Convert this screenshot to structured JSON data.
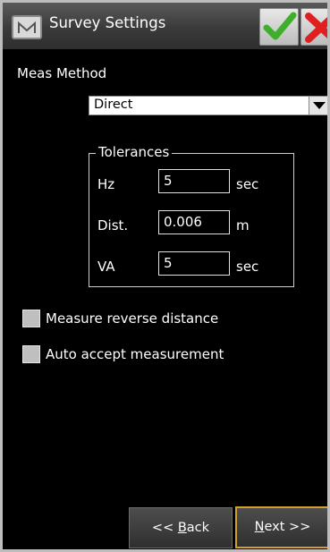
{
  "window": {
    "title": "Survey Settings"
  },
  "meas_method": {
    "label": "Meas Method",
    "selected": "Direct"
  },
  "tolerances": {
    "group_label": "Tolerances",
    "rows": [
      {
        "label": "Hz",
        "value": "5",
        "unit": "sec"
      },
      {
        "label": "Dist.",
        "value": "0.006",
        "unit": "m"
      },
      {
        "label": "VA",
        "value": "5",
        "unit": "sec"
      }
    ]
  },
  "options": {
    "measure_reverse": {
      "label": "Measure reverse distance",
      "checked": false
    },
    "auto_accept": {
      "label": "Auto accept measurement",
      "checked": false
    }
  },
  "nav": {
    "back": {
      "prefix": "<< ",
      "accel": "B",
      "rest": "ack"
    },
    "next": {
      "accel": "N",
      "rest": "ext >>"
    }
  },
  "colors": {
    "ok_green": "#3fae2a",
    "cancel_red": "#e02020",
    "focus_border": "#d4a02a"
  },
  "icons": {
    "app": "app-m-icon",
    "ok": "checkmark-icon",
    "cancel": "close-icon",
    "dropdown": "chevron-down-icon"
  }
}
